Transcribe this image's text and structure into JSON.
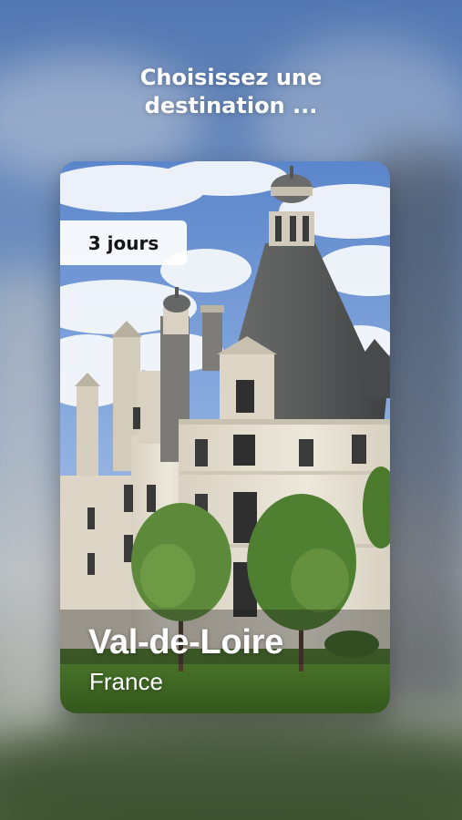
{
  "prompt": {
    "line1": "Choisissez une",
    "line2": "destination ..."
  },
  "card": {
    "duration_badge": "3 jours",
    "place_name": "Val-de-Loire",
    "country": "France",
    "image_subject": "castle-photo"
  },
  "colors": {
    "sky": "#6f95d0",
    "stone": "#e7e2d6",
    "roof": "#5d5f5f",
    "lawn": "#3f6a25",
    "badge_bg": "#ffffff",
    "text": "#ffffff"
  }
}
